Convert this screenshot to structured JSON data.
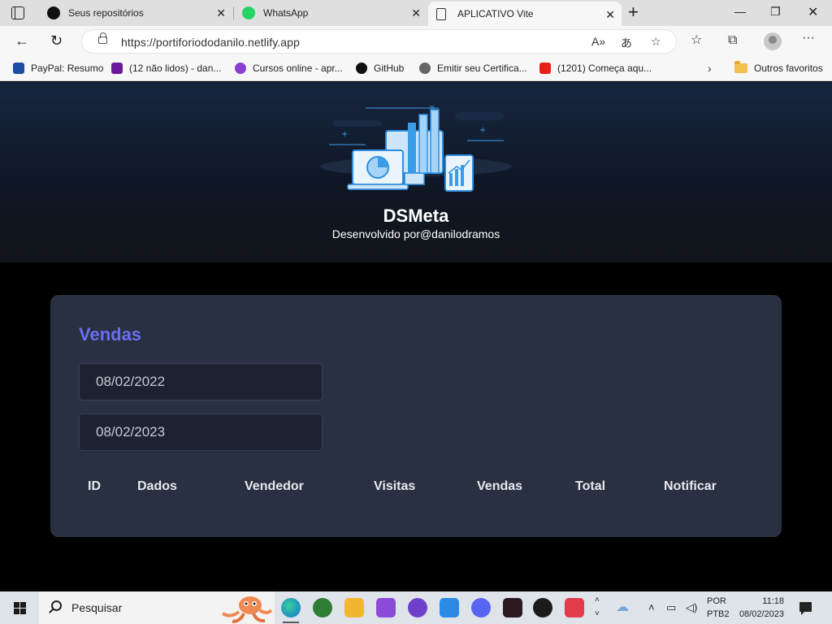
{
  "browser": {
    "tabs": [
      {
        "title": "Seus repositórios",
        "icon": "github-icon",
        "active": false
      },
      {
        "title": "WhatsApp",
        "icon": "whatsapp-icon",
        "active": false
      },
      {
        "title": "APLICATIVO Vite",
        "icon": "page-icon",
        "active": true
      }
    ],
    "url": "https://portiforiododanilo.netlify.app",
    "favorites": [
      {
        "label": "PayPal: Resumo",
        "icon": "paypal-icon",
        "color": "#1a4fa3"
      },
      {
        "label": "(12 não lidos) - dan...",
        "icon": "yahoo-mail-icon",
        "color": "#6a1b9a"
      },
      {
        "label": "Cursos online - apr...",
        "icon": "udemy-icon",
        "color": "#8b3fd1"
      },
      {
        "label": "GitHub",
        "icon": "github-icon",
        "color": "#111111"
      },
      {
        "label": "Emitir seu Certifica...",
        "icon": "certificate-icon",
        "color": "#555555"
      },
      {
        "label": "(1201) Começa aqu...",
        "icon": "youtube-icon",
        "color": "#e62117"
      }
    ],
    "other_favorites": "Outros favoritos"
  },
  "app": {
    "brand": "DSMeta",
    "credit": "Desenvolvido por@danilodramos",
    "card": {
      "title": "Vendas",
      "date_min": "08/02/2022",
      "date_max": "08/02/2023",
      "columns": [
        "ID",
        "Dados",
        "Vendedor",
        "Visitas",
        "Vendas",
        "Total",
        "Notificar"
      ]
    }
  },
  "taskbar": {
    "search_placeholder": "Pesquisar",
    "lang_1": "POR",
    "lang_2": "PTB2",
    "time": "11:18",
    "date": "08/02/2023"
  },
  "colors": {
    "accent": "#6a6ff0",
    "card_bg": "#283041",
    "input_bg": "#1c2230"
  }
}
